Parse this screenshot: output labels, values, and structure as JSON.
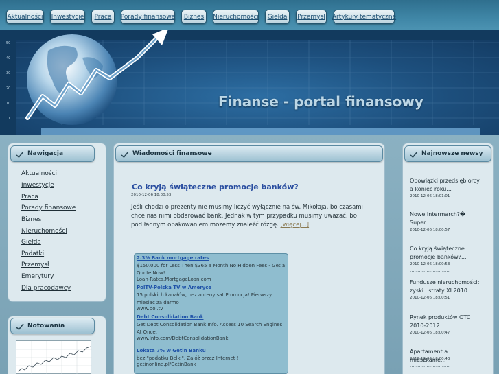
{
  "nav": {
    "items": [
      {
        "label": "Aktualności"
      },
      {
        "label": "Inwestycje"
      },
      {
        "label": "Praca"
      },
      {
        "label": "Porady finansowe"
      },
      {
        "label": "Biznes"
      },
      {
        "label": "Nieruchomości"
      },
      {
        "label": "Giełda"
      },
      {
        "label": "Przemysł"
      },
      {
        "label": "Artykuły tematyczne"
      }
    ]
  },
  "banner": {
    "title": "Finanse - portal finansowy",
    "axis_labels": [
      "50",
      "40",
      "30",
      "20",
      "10",
      "0"
    ]
  },
  "sidebar": {
    "nav_title": "Nawigacja",
    "items": [
      {
        "label": "Aktualności"
      },
      {
        "label": "Inwestycje"
      },
      {
        "label": "Praca"
      },
      {
        "label": "Porady finansowe"
      },
      {
        "label": "Biznes"
      },
      {
        "label": "Nieruchomości"
      },
      {
        "label": "Giełda"
      },
      {
        "label": "Podatki"
      },
      {
        "label": "Przemysł"
      },
      {
        "label": "Emerytury"
      },
      {
        "label": "Dla pracodawcy"
      }
    ],
    "quotes_title": "Notowania"
  },
  "main": {
    "header": "Wiadomości finansowe",
    "article": {
      "title": "Co kryją świąteczne promocje banków?",
      "date": "2010-12-06 18:00:53",
      "text": "Jeśli chodzi o prezenty nie musimy liczyć wyłącznie na św. Mikołaja, bo czasami chce nas nimi obdarować bank. Jednak w tym przypadku musimy uważać, bo pod ładnym opakowaniem możemy znaleźć rózgę.",
      "more": "[więcej...]"
    },
    "ads": [
      {
        "title": "2.3% Bank mortgage rates",
        "text": "$150.000 for Less Then $365 a Month No Hidden Fees - Get a Quote Now!",
        "url": "Loan-Rates.MortgageLoan.com"
      },
      {
        "title": "PolTV-Polska TV w Ameryce",
        "text": "15 polskich kanałów, bez anteny sat Promocja! Pierwszy miesiac za darmo",
        "url": "www.pol.tv"
      },
      {
        "title": "Debt Consolidation Bank",
        "text": "Get Debt Consolidation Bank Info. Access 10 Search Engines At Once.",
        "url": "www.Info.com/DebtConsolidationBank"
      },
      {
        "title": "Lokata 7% w Getin Banku",
        "text": "bez \"podatku Belki\". Zalóż przez Internet !",
        "url": "getinonline.pl/GetinBank"
      }
    ]
  },
  "news": {
    "title": "Najnowsze newsy",
    "items": [
      {
        "text": "Obowiązki przedsiębiorcy a koniec roku...",
        "date": "2010-12-06 18:01:01"
      },
      {
        "text": "Nowe Intermarch?� Super...",
        "date": "2010-12-06 18:00:57"
      },
      {
        "text": "Co kryją świąteczne promocje banków?...",
        "date": "2010-12-06 18:00:53"
      },
      {
        "text": "Fundusze nieruchomości: zyski i straty XI 2010...",
        "date": "2010-12-06 18:00:51"
      },
      {
        "text": "Rynek produktów OTC 2010-2012...",
        "date": "2010-12-06 18:00:47"
      },
      {
        "text": "Apartament a mieszkanie...",
        "date": "2010-12-06 18:00:43"
      }
    ],
    "dots": "............................."
  },
  "colors": {
    "accent": "#2a4ea0",
    "nav_bg": "#3f86a6",
    "panel_bg": "#dde9ee"
  }
}
